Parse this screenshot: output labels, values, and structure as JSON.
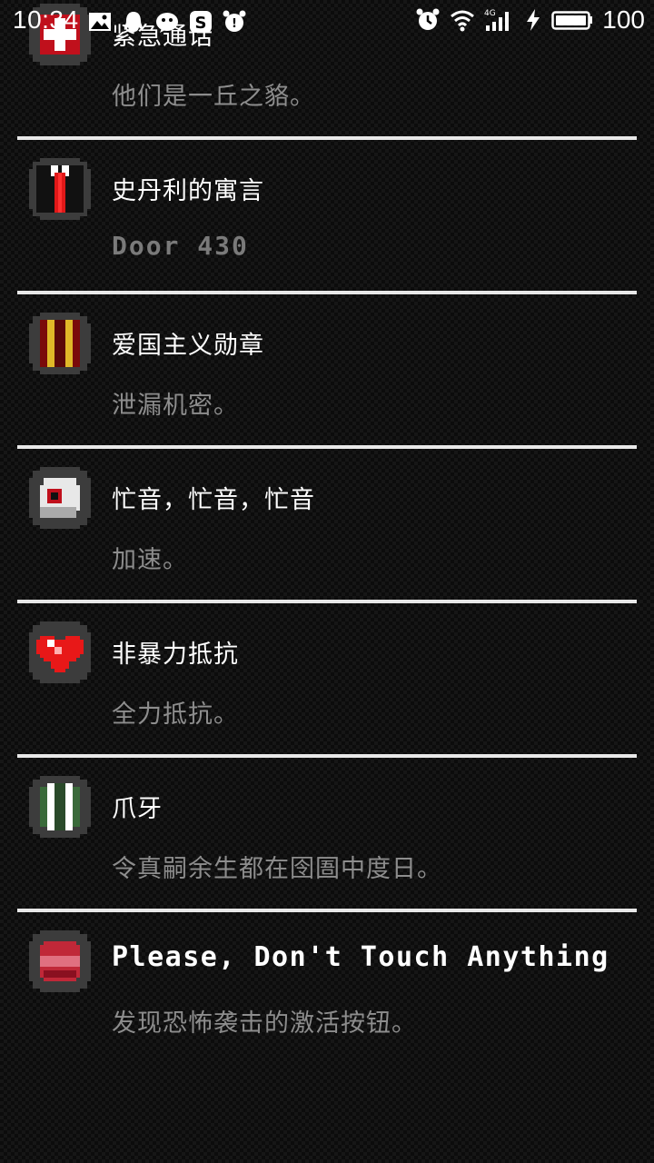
{
  "status_bar": {
    "time": "10:34",
    "battery_percent": "100",
    "network": "4G"
  },
  "achievements": [
    {
      "icon": "red-cross-badge-icon",
      "title": "紧急通话",
      "subtitle": "他们是一丘之貉。",
      "latin_title": false,
      "latin_subtitle": false
    },
    {
      "icon": "black-tie-icon",
      "title": "史丹利的寓言",
      "subtitle": "Door 430",
      "latin_title": false,
      "latin_subtitle": true
    },
    {
      "icon": "patriot-medal-icon",
      "title": "爱国主义勋章",
      "subtitle": "泄漏机密。",
      "latin_title": false,
      "latin_subtitle": false
    },
    {
      "icon": "eyeball-icon",
      "title": "忙音，忙音，忙音",
      "subtitle": "加速。",
      "latin_title": false,
      "latin_subtitle": false
    },
    {
      "icon": "red-heart-icon",
      "title": "非暴力抵抗",
      "subtitle": "全力抵抗。",
      "latin_title": false,
      "latin_subtitle": false
    },
    {
      "icon": "claw-stripes-icon",
      "title": "爪牙",
      "subtitle": "令真嗣余生都在囹圄中度日。",
      "latin_title": false,
      "latin_subtitle": false
    },
    {
      "icon": "red-button-icon",
      "title": "Please, Don't Touch Anything",
      "subtitle": "发现恐怖袭击的激活按钮。",
      "latin_title": true,
      "latin_subtitle": false
    }
  ]
}
